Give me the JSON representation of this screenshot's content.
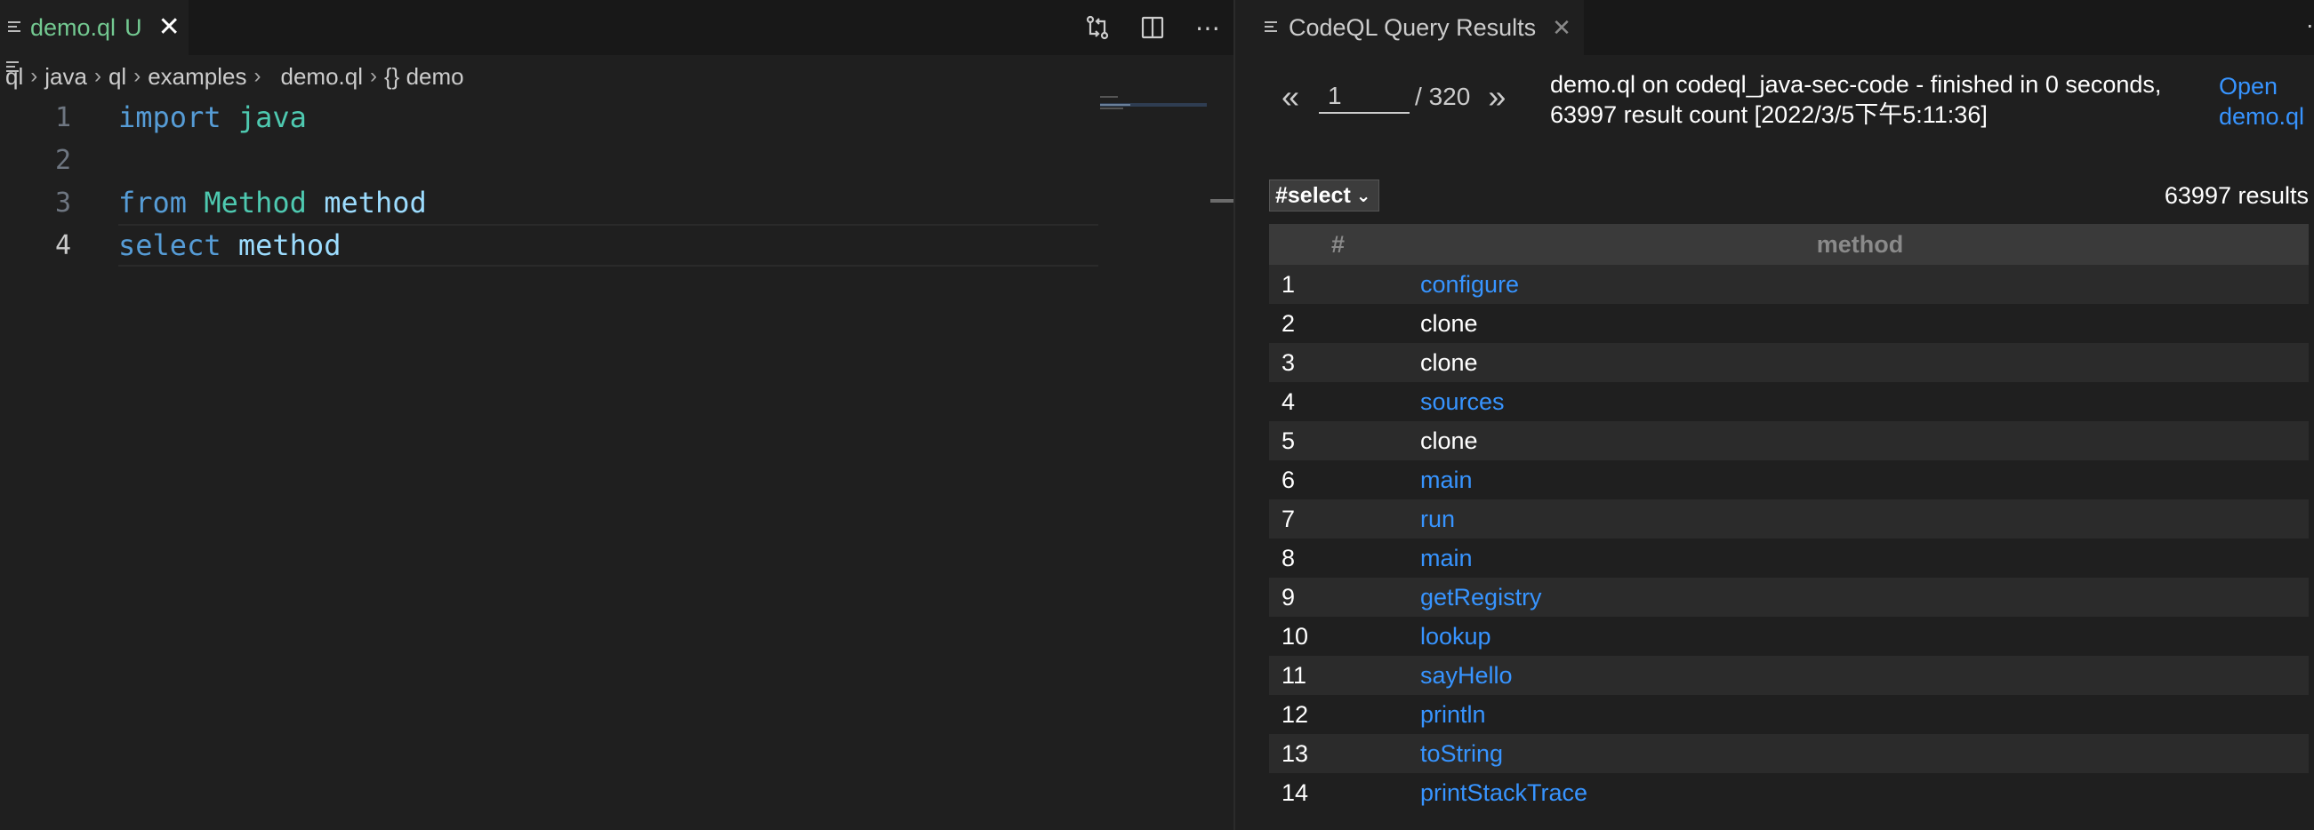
{
  "editor": {
    "tab": {
      "filename": "demo.ql",
      "status": "U",
      "close": "✕"
    },
    "toolbar": {
      "compare": "compare-changes-icon",
      "split": "split-editor-icon",
      "more": "⋯"
    },
    "breadcrumb": [
      "ql",
      "java",
      "ql",
      "examples",
      "demo.ql",
      "{} demo"
    ],
    "lines": [
      {
        "num": "1",
        "tokens": [
          {
            "t": "import",
            "c": "kw"
          },
          {
            "t": " "
          },
          {
            "t": "java",
            "c": "ty"
          }
        ]
      },
      {
        "num": "2",
        "tokens": []
      },
      {
        "num": "3",
        "tokens": [
          {
            "t": "from",
            "c": "kw"
          },
          {
            "t": " "
          },
          {
            "t": "Method",
            "c": "ty"
          },
          {
            "t": " "
          },
          {
            "t": "method",
            "c": "var"
          }
        ]
      },
      {
        "num": "4",
        "tokens": [
          {
            "t": "select",
            "c": "kw"
          },
          {
            "t": " "
          },
          {
            "t": "method",
            "c": "var"
          }
        ]
      }
    ]
  },
  "results_panel": {
    "tab": {
      "title": "CodeQL Query Results",
      "close": "✕"
    },
    "pagination": {
      "prev": "«",
      "page": "1",
      "total": "/ 320",
      "next": "»"
    },
    "status": "demo.ql on codeql_java-sec-code - finished in 0 seconds, 63997 result count [2022/3/5下午5:11:36]",
    "open_link": "Open demo.ql",
    "select": {
      "value": "#select"
    },
    "result_count": "63997 results",
    "columns": [
      "#",
      "method"
    ],
    "rows": [
      {
        "n": "1",
        "v": "configure",
        "link": true
      },
      {
        "n": "2",
        "v": "clone",
        "link": false
      },
      {
        "n": "3",
        "v": "clone",
        "link": false
      },
      {
        "n": "4",
        "v": "sources",
        "link": true
      },
      {
        "n": "5",
        "v": "clone",
        "link": false
      },
      {
        "n": "6",
        "v": "main",
        "link": true
      },
      {
        "n": "7",
        "v": "run",
        "link": true
      },
      {
        "n": "8",
        "v": "main",
        "link": true
      },
      {
        "n": "9",
        "v": "getRegistry",
        "link": true
      },
      {
        "n": "10",
        "v": "lookup",
        "link": true
      },
      {
        "n": "11",
        "v": "sayHello",
        "link": true
      },
      {
        "n": "12",
        "v": "println",
        "link": true
      },
      {
        "n": "13",
        "v": "toString",
        "link": true
      },
      {
        "n": "14",
        "v": "printStackTrace",
        "link": true
      }
    ]
  }
}
